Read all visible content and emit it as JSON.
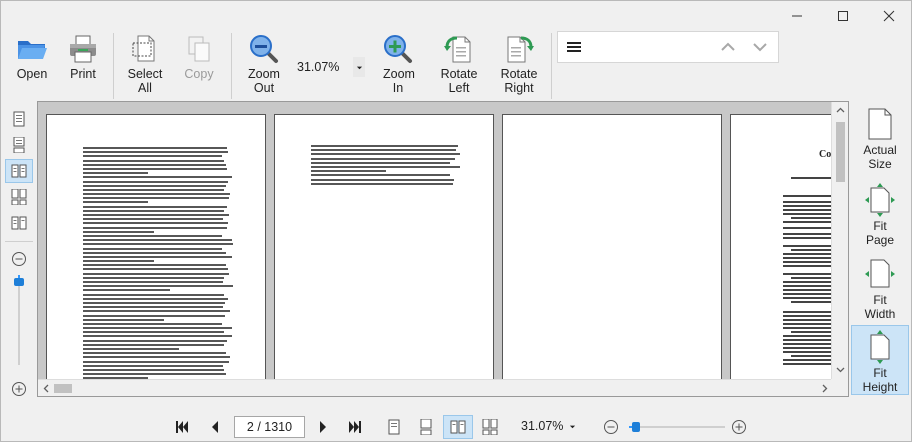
{
  "toolbar": {
    "open_label": "Open",
    "print_label": "Print",
    "select_all_label": "Select All",
    "copy_label": "Copy",
    "zoom_out_label": "Zoom Out",
    "zoom_value": "31.07%",
    "zoom_in_label": "Zoom In",
    "rotate_left_label": "Rotate Left",
    "rotate_right_label": "Rotate Right"
  },
  "right_panel": {
    "actual_size_label": "Actual Size",
    "fit_page_label": "Fit Page",
    "fit_width_label": "Fit Width",
    "fit_height_label": "Fit Height",
    "active": "fit_height"
  },
  "navigation": {
    "page_indicator": "2 / 1310",
    "zoom_value": "31.07%"
  },
  "zoom_level": 31.07,
  "icons": {
    "open": "folder-open-icon",
    "print": "printer-icon",
    "select_all": "select-all-icon",
    "copy": "copy-icon",
    "zoom_out": "magnifier-minus-icon",
    "zoom_in": "magnifier-plus-icon",
    "rotate_left": "rotate-left-icon",
    "rotate_right": "rotate-right-icon"
  },
  "colors": {
    "accent": "#3399ff",
    "active_bg": "#cce4f7",
    "icon_blue": "#1e6fd0",
    "icon_green": "#2e9a53"
  },
  "pages": [
    {
      "id": "page-1",
      "type": "text"
    },
    {
      "id": "page-2",
      "type": "text"
    },
    {
      "id": "page-3",
      "type": "blank"
    },
    {
      "id": "page-4",
      "type": "contents",
      "title": "Co"
    }
  ],
  "toc_labels": {
    "preface": "Preface",
    "chapter1": "Chapter 1: Introdu",
    "chapter2": "Chapter 2: Overvie",
    "chapter3": "Chapter 3: Syntax",
    "chapter4": "Chapter 4: Graphic"
  }
}
